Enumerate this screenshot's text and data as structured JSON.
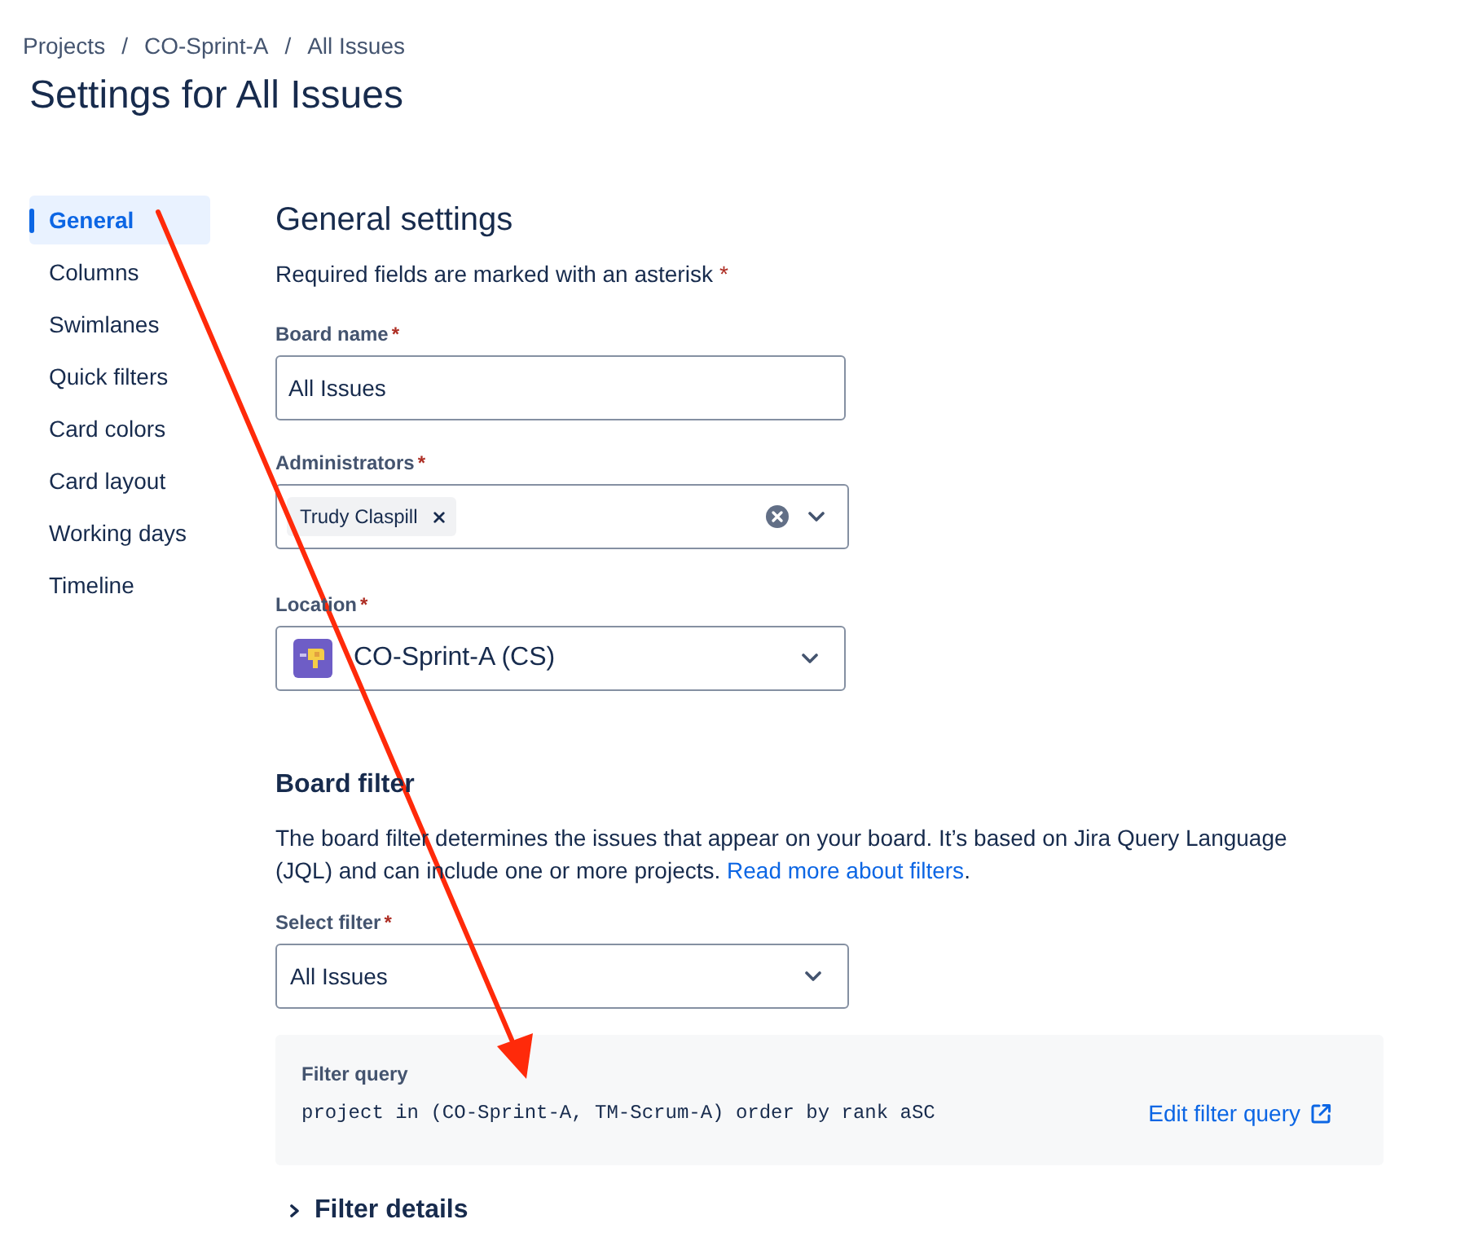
{
  "breadcrumbs": [
    {
      "label": "Projects",
      "separator": "/"
    },
    {
      "label": "CO-Sprint-A",
      "separator": "/"
    },
    {
      "label": "All Issues"
    }
  ],
  "page_title": "Settings for All Issues",
  "sidebar": {
    "items": [
      {
        "label": "General",
        "selected": true
      },
      {
        "label": "Columns",
        "selected": false
      },
      {
        "label": "Swimlanes",
        "selected": false
      },
      {
        "label": "Quick filters",
        "selected": false
      },
      {
        "label": "Card colors",
        "selected": false
      },
      {
        "label": "Card layout",
        "selected": false
      },
      {
        "label": "Working days",
        "selected": false
      },
      {
        "label": "Timeline",
        "selected": false
      }
    ]
  },
  "general_settings": {
    "heading": "General settings",
    "note": "Required fields are marked with an asterisk",
    "note_mark": "*",
    "fields": [
      {
        "kind": "text",
        "label": "Board name",
        "required_mark": "*",
        "value": "All Issues"
      },
      {
        "kind": "multi_select",
        "label": "Administrators",
        "required_mark": "*",
        "tags": [
          {
            "label": "Trudy Claspill"
          }
        ]
      },
      {
        "kind": "project_select",
        "label": "Location",
        "required_mark": "*",
        "value": "CO-Sprint-A (CS)"
      }
    ]
  },
  "board_filter": {
    "heading": "Board filter",
    "description": "The board filter determines the issues that appear on your board. It’s based on Jira Query Language (JQL) and can include one or more projects. ",
    "link": "Read more about filters",
    "after_link": ".",
    "fields": [
      {
        "kind": "select",
        "label": "Select filter",
        "required_mark": "*",
        "value": "All Issues"
      }
    ],
    "filter_query": {
      "label": "Filter query",
      "query": "project in (CO-Sprint-A, TM-Scrum-A) order by rank aSC",
      "edit_link": "Edit filter query"
    },
    "filter_details": {
      "label": "Filter details",
      "expanded": false
    }
  },
  "annotations": [
    {
      "kind": "arrow"
    }
  ]
}
